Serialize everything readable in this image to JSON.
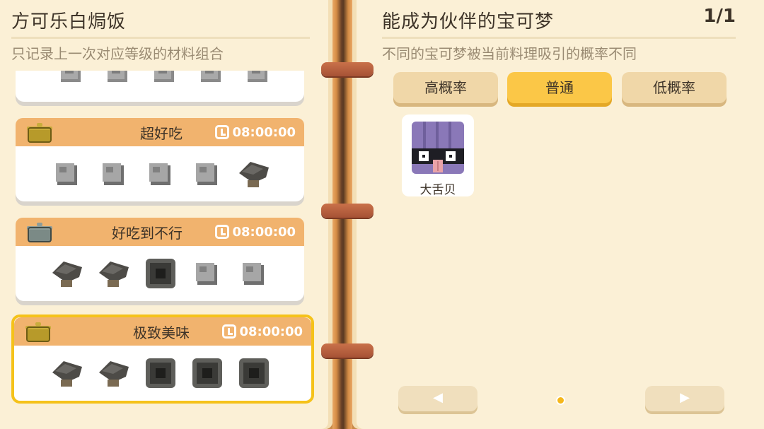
{
  "left": {
    "title": "方可乐白焗饭",
    "subtitle": "只记录上一次对应等级的材料组合"
  },
  "recipes": [
    {
      "name": "",
      "timer": "",
      "pot_color": "#b79a2a"
    },
    {
      "name": "超好吃",
      "timer": "08:00:00",
      "pot_color": "#b79a2a"
    },
    {
      "name": "好吃到不行",
      "timer": "08:00:00",
      "pot_color": "#7b8a86"
    },
    {
      "name": "极致美味",
      "timer": "08:00:00",
      "pot_color": "#b79a2a"
    }
  ],
  "right": {
    "title": "能成为伙伴的宝可梦",
    "page_indicator": "1/1",
    "subtitle": "不同的宝可梦被当前料理吸引的概率不同",
    "tabs": [
      {
        "label": "高概率"
      },
      {
        "label": "普通"
      },
      {
        "label": "低概率"
      }
    ],
    "selected_tab": "普通",
    "pokemon": [
      {
        "name": "大舌贝"
      }
    ],
    "prev_icon": "◀",
    "next_icon": "▶"
  },
  "colors": {
    "accent": "#fbc747",
    "card_header": "#f1b36e",
    "selected_border": "#f5c21a"
  }
}
